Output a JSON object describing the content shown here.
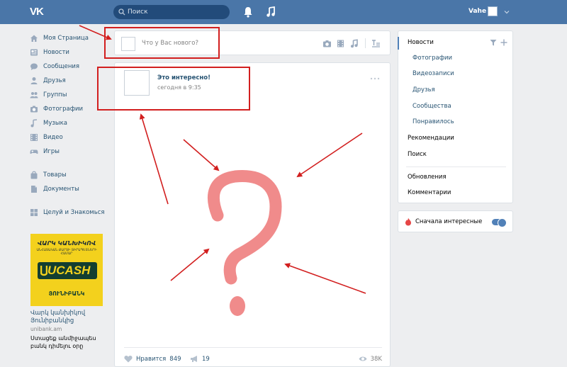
{
  "header": {
    "logo": "VK",
    "search_placeholder": "Поиск",
    "user_name": "Vahe"
  },
  "leftnav": {
    "items": [
      {
        "label": "Моя Страница",
        "icon": "home-icon"
      },
      {
        "label": "Новости",
        "icon": "news-icon"
      },
      {
        "label": "Сообщения",
        "icon": "messages-icon"
      },
      {
        "label": "Друзья",
        "icon": "friends-icon"
      },
      {
        "label": "Группы",
        "icon": "groups-icon"
      },
      {
        "label": "Фотографии",
        "icon": "camera-icon"
      },
      {
        "label": "Музыка",
        "icon": "music-icon"
      },
      {
        "label": "Видео",
        "icon": "video-icon"
      },
      {
        "label": "Игры",
        "icon": "gamepad-icon"
      },
      {
        "label": "Товары",
        "icon": "bag-icon"
      },
      {
        "label": "Документы",
        "icon": "document-icon"
      },
      {
        "label": "Целуй и Знакомься",
        "icon": "apps-icon"
      }
    ]
  },
  "ad": {
    "banner_title": "ՎԱՐԿ ԿԱՆԽԻԿՈՎ",
    "banner_subtitle": "ԱՆՀԱՏԱԿԱՆ ՔԱՐՏԻ ՏԻՐԱՊԵՏՆԵՐԻ ՀԱՄԱՐ",
    "banner_brand": "UCASH",
    "banner_bank": "ՅՈՒՆԻԲԱՆԿ",
    "title": "Վարկ կանխիկով Յունիբանկից",
    "domain": "unibank.am",
    "description": "Ստացեք անմիջապես բանկ դիմելու օրը"
  },
  "composer": {
    "placeholder": "Что у Вас нового?"
  },
  "post": {
    "author": "Это интересно!",
    "time": "сегодня в 9:35",
    "likes_label": "Нравится",
    "likes_count": "849",
    "shares_count": "19",
    "views": "38K"
  },
  "rightnav": {
    "items": [
      {
        "label": "Новости"
      },
      {
        "label": "Фотографии"
      },
      {
        "label": "Видеозаписи"
      },
      {
        "label": "Друзья"
      },
      {
        "label": "Сообщества"
      },
      {
        "label": "Понравилось"
      },
      {
        "label": "Рекомендации"
      },
      {
        "label": "Поиск"
      },
      {
        "label": "Обновления"
      },
      {
        "label": "Комментарии"
      }
    ]
  },
  "interest": {
    "label": "Сначала интересные",
    "enabled": true
  },
  "colors": {
    "header": "#4a76a8",
    "accent": "#5181b8",
    "annotation": "#d21f1f",
    "question_mark": "#f08b8b"
  }
}
